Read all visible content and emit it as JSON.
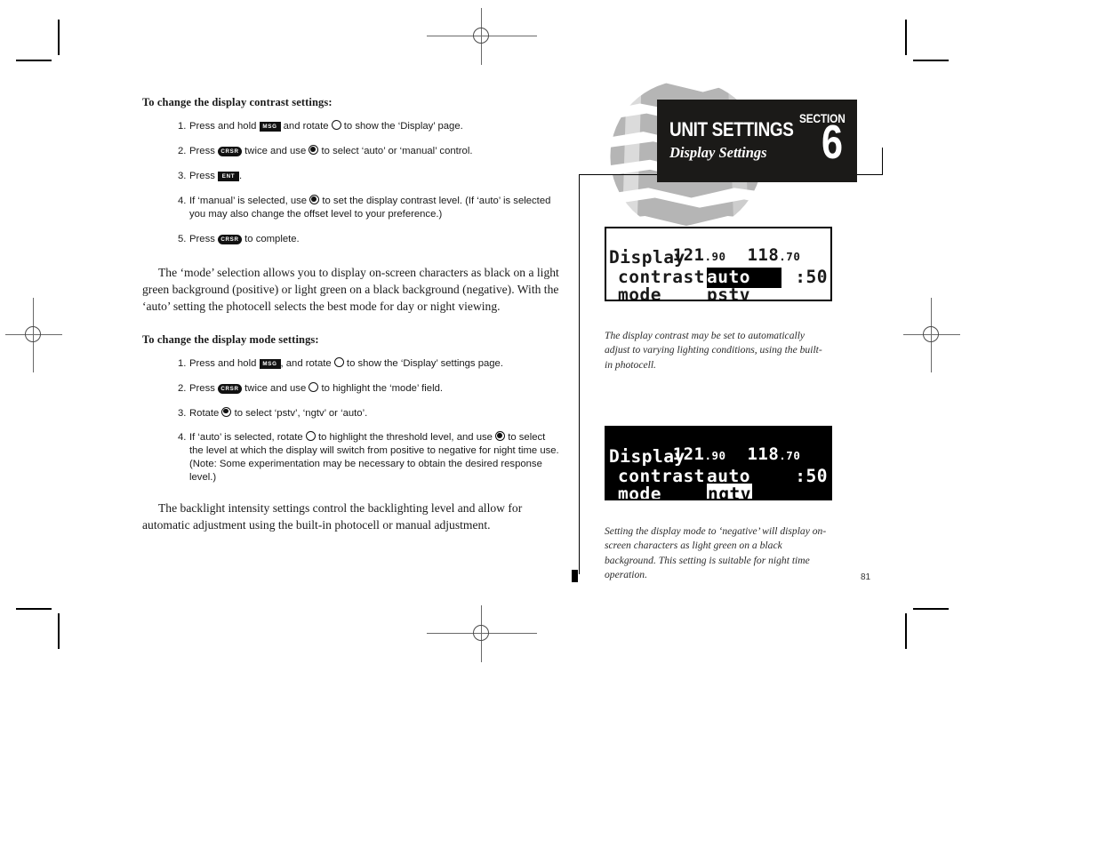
{
  "document": {
    "page_number": "81"
  },
  "banner": {
    "title": "UNIT SETTINGS",
    "subtitle": "Display Settings",
    "section_label": "SECTION",
    "section_number": "6"
  },
  "left_column": {
    "heading_contrast": "To change the display contrast settings:",
    "contrast_steps": [
      {
        "num": "1.",
        "parts": [
          {
            "t": "text",
            "v": "Press and hold "
          },
          {
            "t": "key-rect",
            "v": "MSG"
          },
          {
            "t": "text",
            "v": " and rotate "
          },
          {
            "t": "knob-outer",
            "v": ""
          },
          {
            "t": "text",
            "v": " to show the ‘Display’ page."
          }
        ]
      },
      {
        "num": "2.",
        "parts": [
          {
            "t": "text",
            "v": "Press "
          },
          {
            "t": "key-pill",
            "v": "CRSR"
          },
          {
            "t": "text",
            "v": " twice and use "
          },
          {
            "t": "knob-inner",
            "v": ""
          },
          {
            "t": "text",
            "v": " to select ‘auto’ or ‘manual’ control."
          }
        ]
      },
      {
        "num": "3.",
        "parts": [
          {
            "t": "text",
            "v": "Press "
          },
          {
            "t": "key-rect",
            "v": "ENT"
          },
          {
            "t": "text",
            "v": "."
          }
        ]
      },
      {
        "num": "4.",
        "parts": [
          {
            "t": "text",
            "v": "If ‘manual’ is selected, use "
          },
          {
            "t": "knob-inner",
            "v": ""
          },
          {
            "t": "text",
            "v": " to set the display contrast level. (If ‘auto’ is selected you may also change the offset level to your preference.)"
          }
        ]
      },
      {
        "num": "5.",
        "parts": [
          {
            "t": "text",
            "v": "Press "
          },
          {
            "t": "key-pill",
            "v": "CRSR"
          },
          {
            "t": "text",
            "v": " to complete."
          }
        ]
      }
    ],
    "paragraph_mode": "The ‘mode’ selection allows you to display on-screen characters as black on a light green background (positive) or light green on a black background (negative).  With the ‘auto’ setting the photocell selects the best mode for day or night viewing.",
    "heading_mode": "To change the display mode settings:",
    "mode_steps": [
      {
        "num": "1.",
        "parts": [
          {
            "t": "text",
            "v": "Press and hold "
          },
          {
            "t": "key-rect",
            "v": "MSG"
          },
          {
            "t": "text",
            "v": ", and rotate "
          },
          {
            "t": "knob-outer",
            "v": ""
          },
          {
            "t": "text",
            "v": " to show the ‘Display’ settings page."
          }
        ]
      },
      {
        "num": "2.",
        "parts": [
          {
            "t": "text",
            "v": "Press "
          },
          {
            "t": "key-pill",
            "v": "CRSR"
          },
          {
            "t": "text",
            "v": " twice and use "
          },
          {
            "t": "knob-outer",
            "v": ""
          },
          {
            "t": "text",
            "v": " to highlight the ‘mode’ field."
          }
        ]
      },
      {
        "num": "3.",
        "parts": [
          {
            "t": "text",
            "v": "Rotate "
          },
          {
            "t": "knob-inner",
            "v": ""
          },
          {
            "t": "text",
            "v": " to select ‘pstv’, ‘ngtv’ or ‘auto’."
          }
        ]
      },
      {
        "num": "4.",
        "parts": [
          {
            "t": "text",
            "v": "If ‘auto’ is selected, rotate "
          },
          {
            "t": "knob-outer",
            "v": ""
          },
          {
            "t": "text",
            "v": " to highlight the threshold level, and use "
          },
          {
            "t": "knob-inner",
            "v": ""
          },
          {
            "t": "text",
            "v": " to select the level at which the display will switch from positive to negative for night time use. (Note: Some experimentation may be necessary to obtain the desired response level.)"
          }
        ]
      }
    ],
    "paragraph_backlight": "The backlight intensity settings control the backlighting level and allow for automatic adjustment using the built-in photocell or manual adjustment."
  },
  "lcd_positive": {
    "freq_active_int": "121",
    "freq_active_dec": ".90",
    "freq_standby_int": "118",
    "freq_standby_dec": ".70",
    "page_title": "Display",
    "label_contrast": "contrast",
    "value_contrast": "auto",
    "label_mode": "mode",
    "value_mode": "pstv",
    "level": ":50",
    "highlighted_field": "contrast"
  },
  "lcd_negative": {
    "freq_active_int": "121",
    "freq_active_dec": ".90",
    "freq_standby_int": "118",
    "freq_standby_dec": ".70",
    "page_title": "Display",
    "label_contrast": "contrast",
    "value_contrast": "auto",
    "label_mode": "mode",
    "value_mode": "ngtv",
    "level": ":50",
    "highlighted_field": "mode"
  },
  "captions": {
    "contrast": "The display contrast may be set to automatically adjust to varying lighting conditions, using the built-in photocell.",
    "mode": "Setting the display mode to ‘negative’ will display on-screen characters as light green on a black background.  This setting is suitable for night time operation."
  },
  "colors": {
    "banner_bg": "#1b1a18",
    "globe_gray": "#b3b3b3",
    "paper": "#ffffff",
    "ink": "#1a1a1a"
  }
}
